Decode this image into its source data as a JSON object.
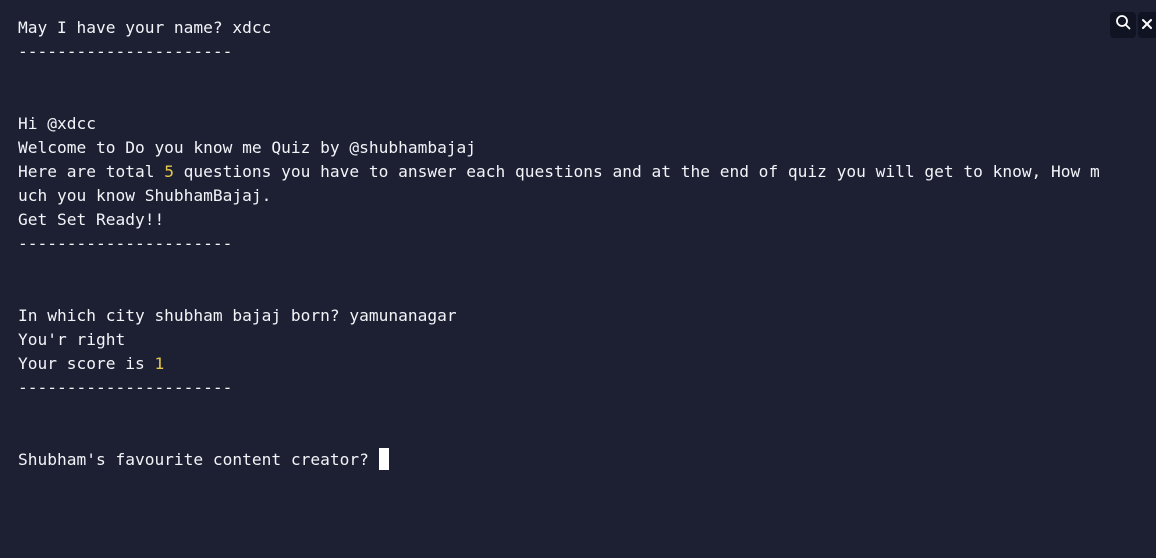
{
  "terminal": {
    "name_prompt": "May I have your name? ",
    "name_answer": "xdcc",
    "separator": "----------------------",
    "greeting": "Hi @xdcc",
    "welcome": "Welcome to Do you know me Quiz by @shubhambajaj",
    "intro_before": "Here are total ",
    "intro_count": "5",
    "intro_after": " questions you have to answer each questions and at the end of quiz you will get to know, How m",
    "intro_wrap": "uch you know ShubhamBajaj.",
    "get_ready": "Get Set Ready!!",
    "q1_prompt": "In which city shubham bajaj born? ",
    "q1_answer": "yamunanagar",
    "q1_result": "You'r right",
    "score_label": "Your score is ",
    "score_value": "1",
    "q2_prompt": "Shubham's favourite content creator?"
  },
  "toolbar": {
    "search_icon": "search-icon",
    "close_icon": "close-icon"
  },
  "colors": {
    "background": "#1d2033",
    "text": "#f2f4f8",
    "number": "#e7c84a",
    "cursor": "#ffffff"
  }
}
